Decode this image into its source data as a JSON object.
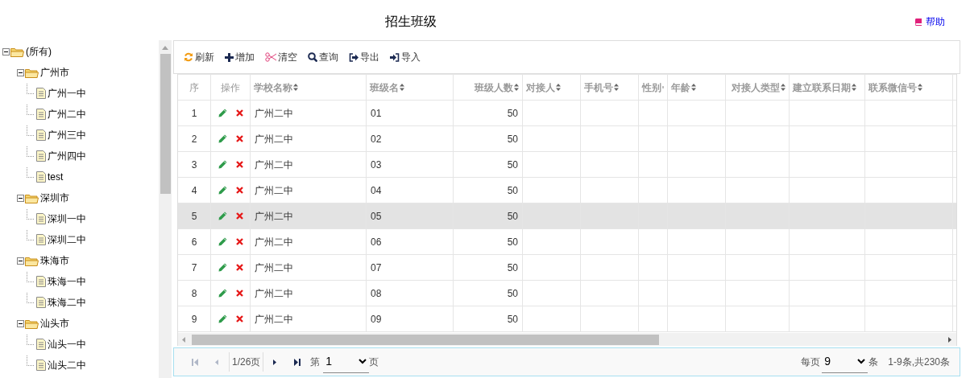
{
  "title": "招生班级",
  "help_link": "帮助",
  "tree": [
    {
      "label": "(所有)",
      "kind": "folder",
      "expanded": true,
      "children": [
        {
          "label": "广州市",
          "kind": "folder",
          "expanded": true,
          "children": [
            {
              "label": "广州一中",
              "kind": "file"
            },
            {
              "label": "广州二中",
              "kind": "file"
            },
            {
              "label": "广州三中",
              "kind": "file"
            },
            {
              "label": "广州四中",
              "kind": "file"
            },
            {
              "label": "test",
              "kind": "file"
            }
          ]
        },
        {
          "label": "深圳市",
          "kind": "folder",
          "expanded": true,
          "children": [
            {
              "label": "深圳一中",
              "kind": "file"
            },
            {
              "label": "深圳二中",
              "kind": "file"
            }
          ]
        },
        {
          "label": "珠海市",
          "kind": "folder",
          "expanded": true,
          "children": [
            {
              "label": "珠海一中",
              "kind": "file"
            },
            {
              "label": "珠海二中",
              "kind": "file"
            }
          ]
        },
        {
          "label": "汕头市",
          "kind": "folder",
          "expanded": true,
          "children": [
            {
              "label": "汕头一中",
              "kind": "file"
            },
            {
              "label": "汕头二中",
              "kind": "file"
            }
          ]
        }
      ]
    }
  ],
  "toolbar": [
    {
      "kind": "refresh",
      "label": "刷新"
    },
    {
      "kind": "add",
      "label": "增加"
    },
    {
      "kind": "clear",
      "label": "清空"
    },
    {
      "kind": "search",
      "label": "查询"
    },
    {
      "kind": "export",
      "label": "导出"
    },
    {
      "kind": "import",
      "label": "导入"
    }
  ],
  "table": {
    "columns": [
      {
        "label": "序",
        "sortable": false
      },
      {
        "label": "操作",
        "sortable": false
      },
      {
        "label": "学校名称",
        "sortable": true
      },
      {
        "label": "班级名",
        "sortable": true
      },
      {
        "label": "班级人数",
        "sortable": true
      },
      {
        "label": "对接人",
        "sortable": true
      },
      {
        "label": "手机号",
        "sortable": true
      },
      {
        "label": "性别",
        "sortable": true
      },
      {
        "label": "年龄",
        "sortable": true
      },
      {
        "label": "对接人类型",
        "sortable": true
      },
      {
        "label": "建立联系日期",
        "sortable": true
      },
      {
        "label": "联系微信号",
        "sortable": true
      }
    ],
    "rows": [
      {
        "index": "1",
        "school": "广州二中",
        "class_name": "01",
        "count": "50",
        "selected": false
      },
      {
        "index": "2",
        "school": "广州二中",
        "class_name": "02",
        "count": "50",
        "selected": false
      },
      {
        "index": "3",
        "school": "广州二中",
        "class_name": "03",
        "count": "50",
        "selected": false
      },
      {
        "index": "4",
        "school": "广州二中",
        "class_name": "04",
        "count": "50",
        "selected": false
      },
      {
        "index": "5",
        "school": "广州二中",
        "class_name": "05",
        "count": "50",
        "selected": true
      },
      {
        "index": "6",
        "school": "广州二中",
        "class_name": "06",
        "count": "50",
        "selected": false
      },
      {
        "index": "7",
        "school": "广州二中",
        "class_name": "07",
        "count": "50",
        "selected": false
      },
      {
        "index": "8",
        "school": "广州二中",
        "class_name": "08",
        "count": "50",
        "selected": false
      },
      {
        "index": "9",
        "school": "广州二中",
        "class_name": "09",
        "count": "50",
        "selected": false
      }
    ]
  },
  "pager": {
    "first_disabled": true,
    "prev_disabled": true,
    "page_info": "1/26页",
    "next_disabled": false,
    "last_disabled": false,
    "page_prefix": "第",
    "page_value": "1",
    "page_suffix": "页",
    "per_page_prefix": "每页",
    "per_page_value": "9",
    "per_page_suffix": "条",
    "summary": "1-9条,共230条"
  }
}
